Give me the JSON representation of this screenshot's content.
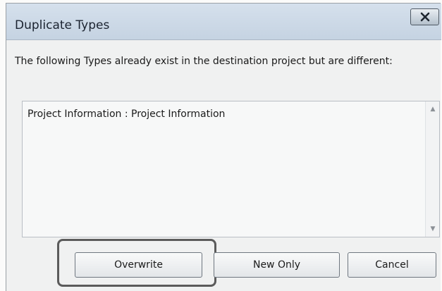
{
  "dialog": {
    "title": "Duplicate Types",
    "close_icon": "close-x-icon",
    "message": "The following Types already exist in the destination project but are different:"
  },
  "types_list": {
    "items": [
      "Project Information : Project Information"
    ],
    "scroll_up_icon": "scroll-up-arrow-icon",
    "scroll_down_icon": "scroll-down-arrow-icon"
  },
  "buttons": {
    "overwrite": "Overwrite",
    "new_only": "New Only",
    "cancel": "Cancel"
  }
}
